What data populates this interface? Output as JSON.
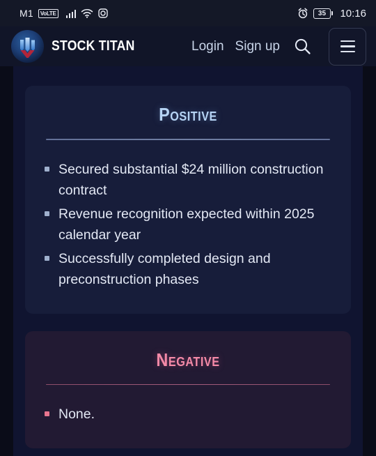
{
  "status_bar": {
    "carrier": "M1",
    "network_badge": "VoLTE",
    "signal_icon": "signal-bars-icon",
    "wifi_icon": "wifi-icon",
    "camera_icon": "camera-icon",
    "alarm_icon": "alarm-clock-icon",
    "battery_level": "35",
    "time": "10:16"
  },
  "header": {
    "logo_icon": "stock-titan-logo-icon",
    "brand": "STOCK TITAN",
    "login_label": "Login",
    "signup_label": "Sign up",
    "search_icon": "search-icon",
    "menu_icon": "hamburger-menu-icon"
  },
  "cards": [
    {
      "id": "positive",
      "title": "Positive",
      "accent": "#b6d4f5",
      "background": "#171d3a",
      "bullets": [
        "Secured substantial $24 million construction contract",
        "Revenue recognition expected within 2025 calendar year",
        "Successfully completed design and preconstruction phases"
      ]
    },
    {
      "id": "negative",
      "title": "Negative",
      "accent": "#f58aa8",
      "background": "#221a33",
      "bullets": [
        "None."
      ]
    }
  ]
}
